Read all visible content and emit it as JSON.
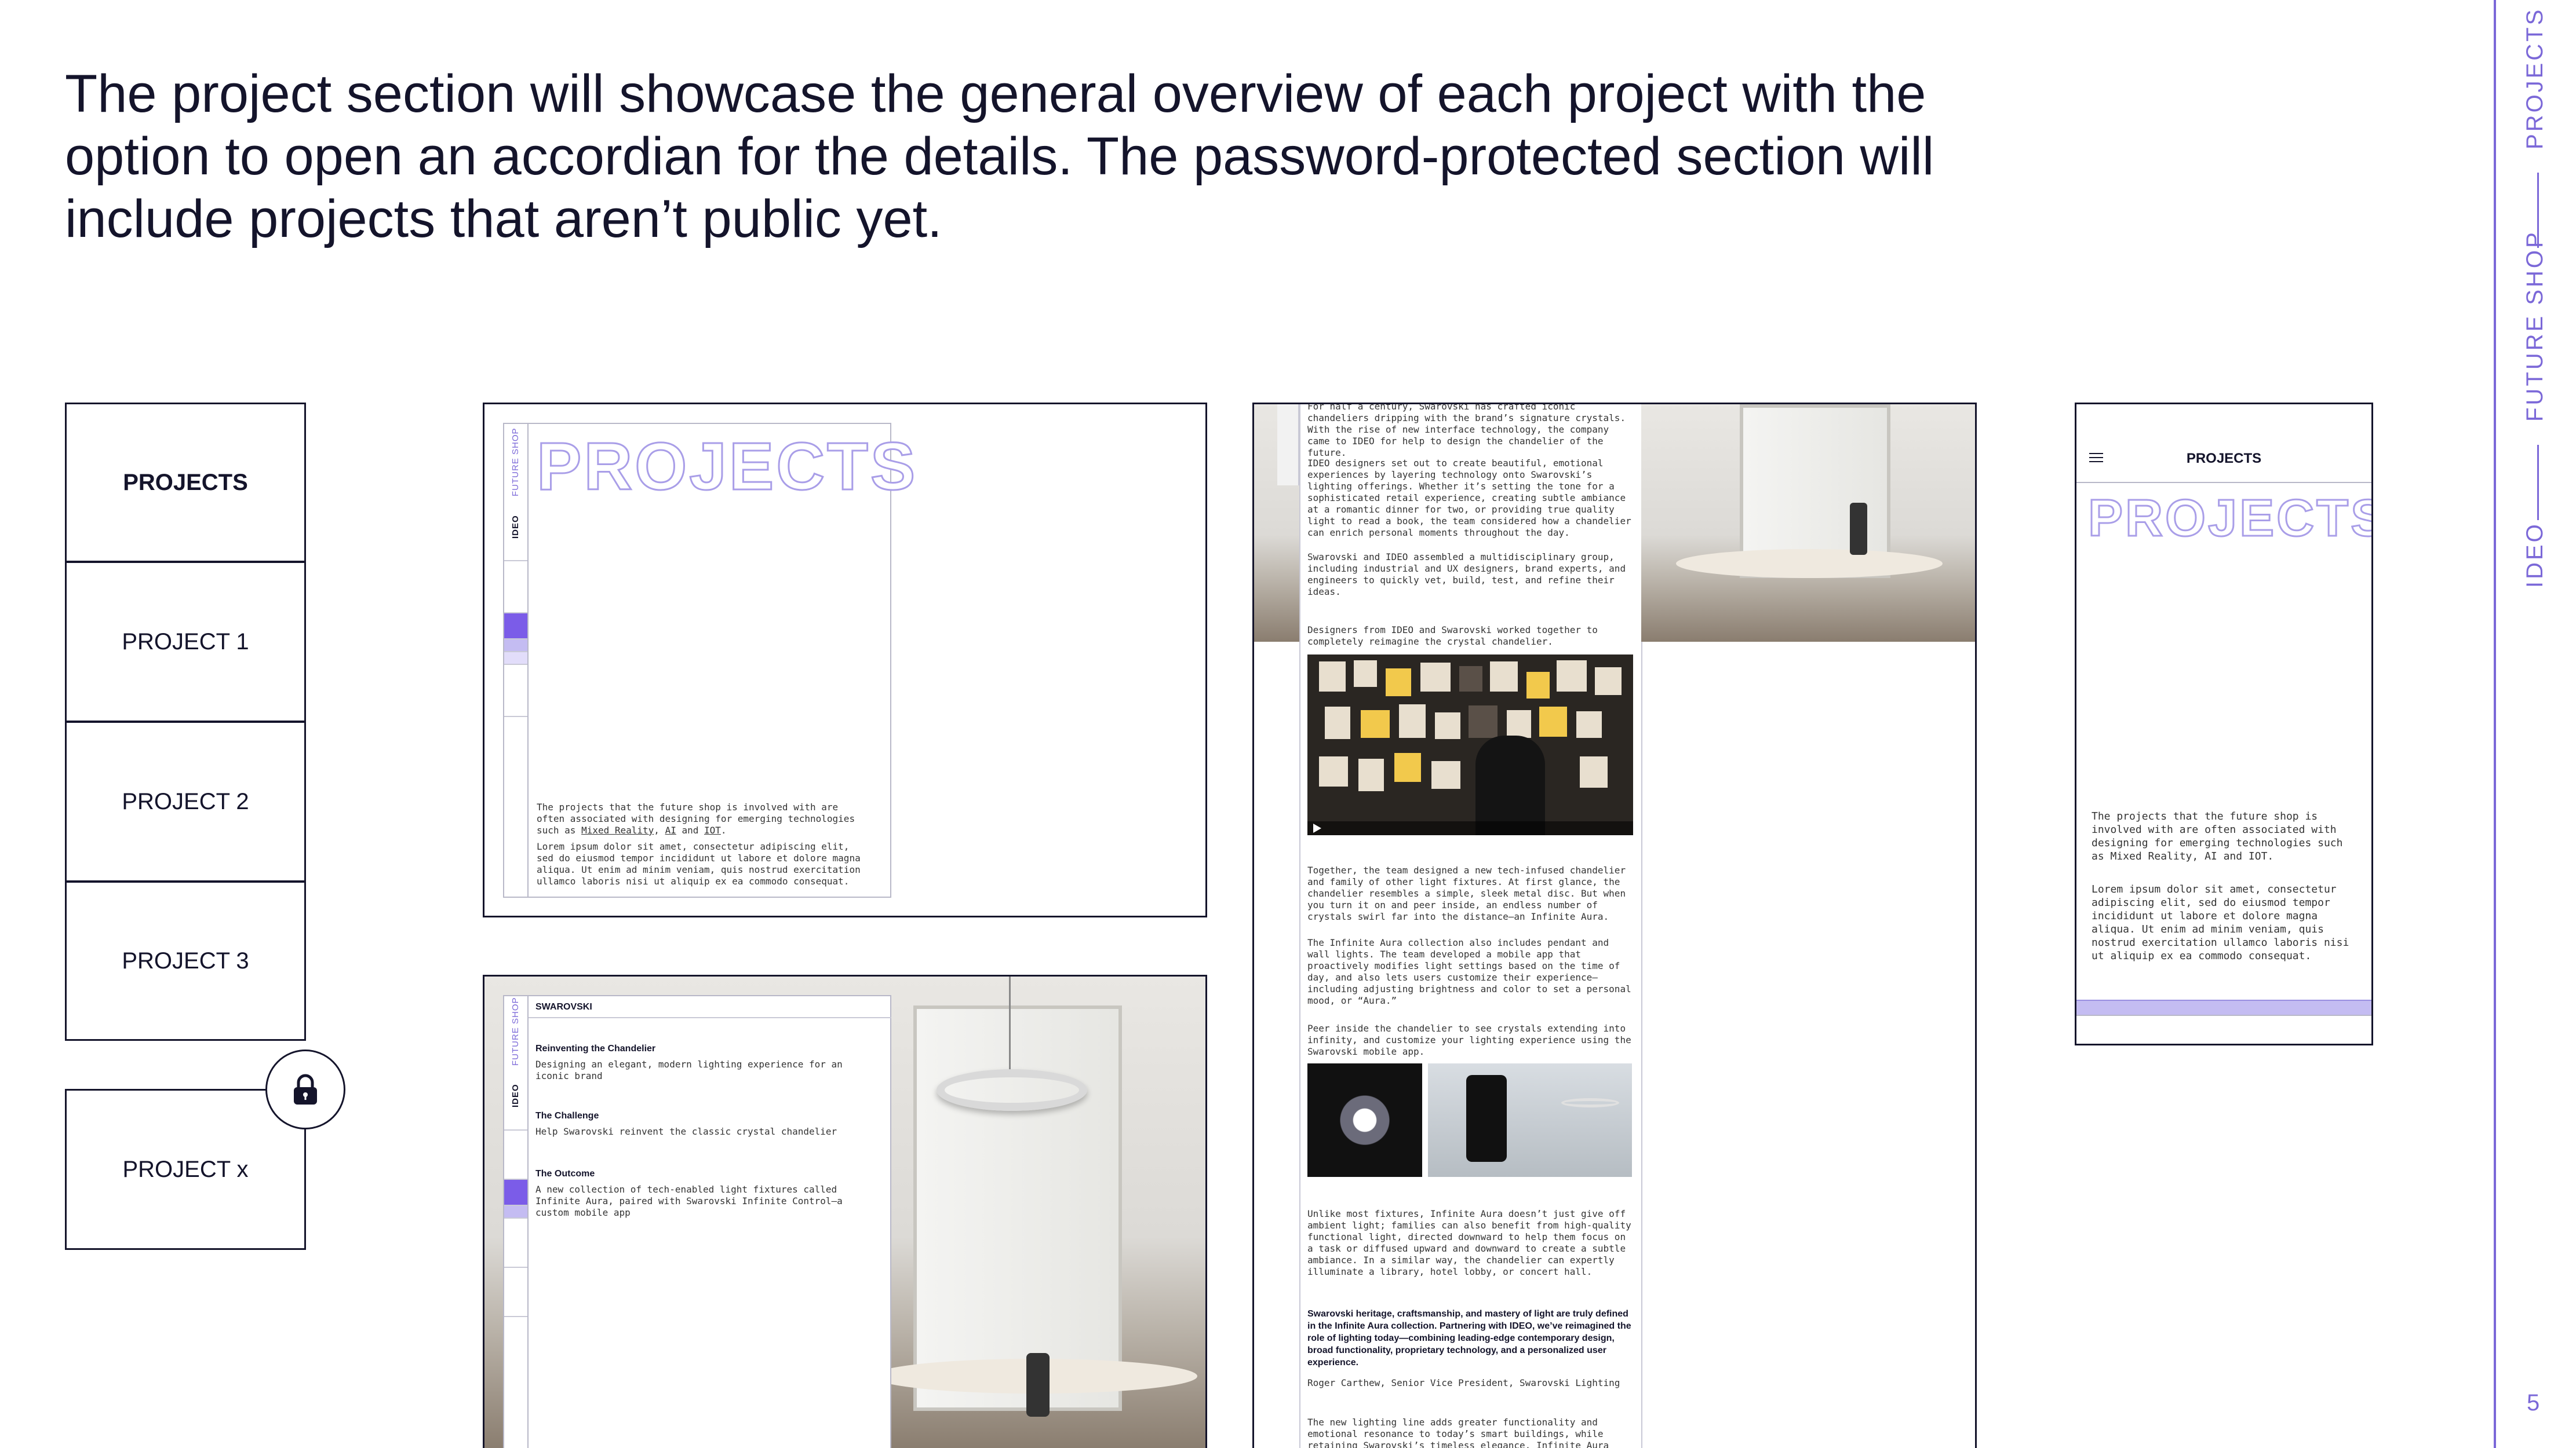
{
  "headline": "The project section will showcase the general overview of each project with the option to open an accordian for the details. The password-protected section will include projects that aren’t public yet.",
  "rail": {
    "section": "PROJECTS",
    "subsection": "FUTURE SHOP",
    "brand": "IDEO",
    "page_number": "5"
  },
  "project_list": {
    "items": [
      "PROJECTS",
      "PROJECT 1",
      "PROJECT 2",
      "PROJECT 3"
    ],
    "locked_item": "PROJECT x",
    "lock_icon": "lock-icon"
  },
  "desktop_overview": {
    "brand": "IDEO",
    "subbrand": "FUTURE SHOP",
    "title": "PROJECTS",
    "intro_prefix": "The projects that the future shop is involved with are often associated with designing for emerging technologies such as ",
    "intro_link1": "Mixed Reality",
    "intro_sep": ", ",
    "intro_link2": "AI",
    "intro_and": " and ",
    "intro_link3": "IOT",
    "intro_end": ".",
    "lorem": "Lorem ipsum dolor sit amet, consectetur adipiscing elit, sed do eiusmod tempor incididunt ut labore et dolore magna aliqua. Ut enim ad minim veniam, quis nostrud exercitation ullamco laboris nisi ut aliquip ex ea commodo consequat."
  },
  "desktop_project": {
    "brand": "IDEO",
    "subbrand": "FUTURE SHOP",
    "client": "SWAROVSKI",
    "heading1": "Reinventing the Chandelier",
    "text1": "Designing an elegant, modern lighting experience for an iconic brand",
    "heading2": "The Challenge",
    "text2": "Help Swarovski reinvent the classic crystal chandelier",
    "heading3": "The Outcome",
    "text3": "A new collection of tech-enabled light fixtures called Infinite Aura, paired with Swarovski Infinite Control—a custom mobile app"
  },
  "article": {
    "p1": "For half a century, Swarovski has crafted iconic chandeliers dripping with the brand’s signature crystals. With the rise of new interface technology, the company came to IDEO for help to design the chandelier of the future.",
    "p2": "IDEO designers set out to create beautiful, emotional experiences by layering technology onto Swarovski’s lighting offerings. Whether it’s setting the tone for a sophisticated retail experience, creating subtle ambiance at a romantic dinner for two, or providing true quality light to read a book, the team considered how a chandelier can enrich personal moments throughout the day.",
    "p3": "Swarovski and IDEO assembled a multidisciplinary group, including industrial and UX designers, brand experts, and engineers to quickly vet, build, test, and refine their ideas.",
    "caption1": "Designers from IDEO and Swarovski worked together to completely reimagine the crystal chandelier.",
    "p4": "Together, the team designed a new tech-infused chandelier and family of other light fixtures. At first glance, the chandelier resembles a simple, sleek metal disc. But when you turn it on and peer inside, an endless number of crystals swirl far into the distance—an Infinite Aura.",
    "p5": "The Infinite Aura collection also includes pendant and wall lights. The team developed a mobile app that proactively modifies light settings based on the time of day, and also lets users customize their experience—including adjusting brightness and color to set a personal mood, or “Aura.”",
    "caption2": "Peer inside the chandelier to see crystals extending into infinity, and customize your lighting experience using the Swarovski mobile app.",
    "p6": "Unlike most fixtures, Infinite Aura doesn’t just give off ambient light; families can also benefit from high-quality functional light, directed downward to help them focus on a task or diffused upward and downward to create a subtle ambiance. In a similar way, the chandelier can expertly illuminate a library, hotel lobby, or concert hall.",
    "quote": "Swarovski heritage, craftsmanship, and mastery of light are truly defined in the Infinite Aura collection. Partnering with IDEO, we’ve reimagined the role of lighting today—combining leading-edge contemporary design, broad functionality, proprietary technology, and a personalized user experience.",
    "attribution": "Roger Carthew, Senior Vice President, Swarovski Lighting",
    "p7": "The new lighting line adds greater functionality and emotional resonance to today’s smart buildings, while retaining Swarovski’s timeless elegance. Infinite Aura"
  },
  "mobile": {
    "menu_icon": "hamburger-icon",
    "header": "PROJECTS",
    "title": "PROJECTS",
    "intro": "The projects that the future shop is involved with are often associated with designing for emerging technologies such as Mixed Reality, AI and IOT.",
    "lorem": "Lorem ipsum dolor sit amet, consectetur adipiscing elit, sed do eiusmod tempor incididunt ut labore et dolore magna aliqua. Ut enim ad minim veniam, quis nostrud exercitation ullamco laboris nisi ut aliquip ex ea commodo consequat."
  },
  "colors": {
    "accent": "#7b68d8",
    "accent_light": "#c4bcf2",
    "ink": "#14142b"
  }
}
